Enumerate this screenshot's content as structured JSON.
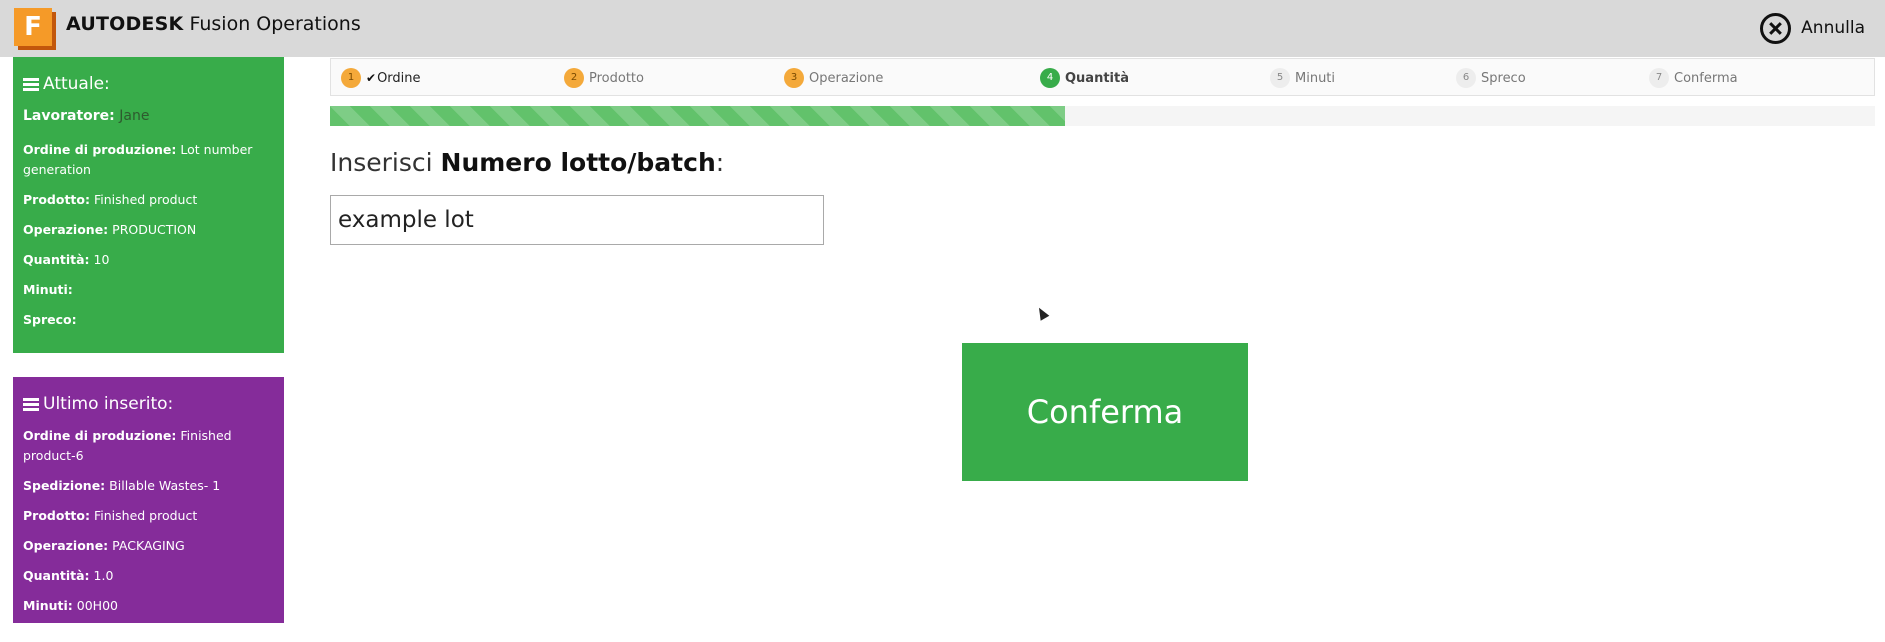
{
  "header": {
    "logo_letter": "F",
    "brand_bold": "AUTODESK",
    "brand_rest": " Fusion Operations",
    "cancel_label": "Annulla"
  },
  "current": {
    "title": "Attuale:",
    "worker_label": "Lavoratore:",
    "worker_value": "Jane",
    "order_label": "Ordine di produzione:",
    "order_value": "Lot number generation",
    "product_label": "Prodotto:",
    "product_value": "Finished product",
    "operation_label": "Operazione:",
    "operation_value": "PRODUCTION",
    "quantity_label": "Quantità:",
    "quantity_value": "10",
    "minutes_label": "Minuti:",
    "minutes_value": "",
    "waste_label": "Spreco:",
    "waste_value": ""
  },
  "last": {
    "title": "Ultimo inserito:",
    "order_label": "Ordine di produzione:",
    "order_value": "Finished product-6",
    "shipment_label": "Spedizione:",
    "shipment_value": "Billable Wastes- 1",
    "product_label": "Prodotto:",
    "product_value": "Finished product",
    "operation_label": "Operazione:",
    "operation_value": "PACKAGING",
    "quantity_label": "Quantità:",
    "quantity_value": "1.0",
    "minutes_label": "Minuti:",
    "minutes_value": "00H00"
  },
  "steps": [
    {
      "num": "1",
      "label": "Ordine",
      "state": "done"
    },
    {
      "num": "2",
      "label": "Prodotto",
      "state": "visited"
    },
    {
      "num": "3",
      "label": "Operazione",
      "state": "visited"
    },
    {
      "num": "4",
      "label": "Quantità",
      "state": "active"
    },
    {
      "num": "5",
      "label": "Minuti",
      "state": "todo"
    },
    {
      "num": "6",
      "label": "Spreco",
      "state": "todo"
    },
    {
      "num": "7",
      "label": "Conferma",
      "state": "todo"
    }
  ],
  "progress_fraction": 0.476,
  "prompt": {
    "prefix": "Inserisci ",
    "bold": "Numero lotto/batch",
    "suffix": ":"
  },
  "lot_input_value": "example lot",
  "confirm_label": "Conferma",
  "colors": {
    "green": "#38ac4a",
    "purple": "#852c9a",
    "orange": "#f4a93a"
  }
}
